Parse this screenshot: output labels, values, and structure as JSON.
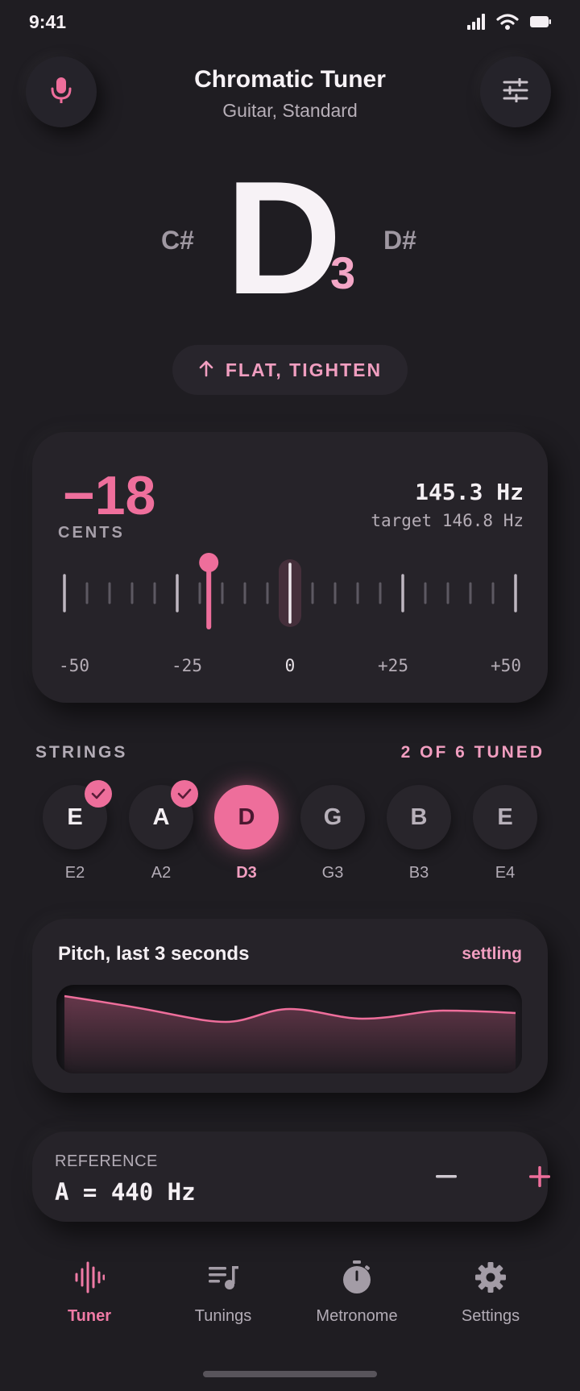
{
  "status_bar": {
    "time": "9:41"
  },
  "header": {
    "title": "Chromatic Tuner",
    "subtitle": "Guitar, Standard"
  },
  "note": {
    "previous": "C#",
    "current": "D",
    "octave": "3",
    "next": "D#"
  },
  "hint": {
    "text": "FLAT, TIGHTEN"
  },
  "cents_card": {
    "cents": "−18",
    "cents_label": "CENTS",
    "frequency": "145.3 Hz",
    "target": "target 146.8 Hz",
    "needle_cents": -18,
    "range": [
      -50,
      50
    ],
    "scale_labels": [
      "-50",
      "-25",
      "0",
      "+25",
      "+50"
    ]
  },
  "strings": {
    "title": "STRINGS",
    "count": "2 OF 6 TUNED",
    "items": [
      {
        "note": "E",
        "name": "E2",
        "state": "tuned"
      },
      {
        "note": "A",
        "name": "A2",
        "state": "tuned"
      },
      {
        "note": "D",
        "name": "D3",
        "state": "active"
      },
      {
        "note": "G",
        "name": "G3",
        "state": "pending"
      },
      {
        "note": "B",
        "name": "B3",
        "state": "pending"
      },
      {
        "note": "E",
        "name": "E4",
        "state": "pending"
      }
    ]
  },
  "pitch_history": {
    "title": "Pitch, last 3 seconds",
    "status": "settling"
  },
  "reference": {
    "label": "REFERENCE",
    "value": "A = 440 Hz"
  },
  "nav": {
    "items": [
      {
        "label": "Tuner",
        "icon": "waveform-icon",
        "active": true
      },
      {
        "label": "Tunings",
        "icon": "playlist-music-icon",
        "active": false
      },
      {
        "label": "Metronome",
        "icon": "stopwatch-icon",
        "active": false
      },
      {
        "label": "Settings",
        "icon": "gear-icon",
        "active": false
      }
    ]
  },
  "colors": {
    "accent": "#ee6e9b",
    "accent_light": "#f19ec0",
    "background": "#1f1d22",
    "card": "#262329"
  }
}
